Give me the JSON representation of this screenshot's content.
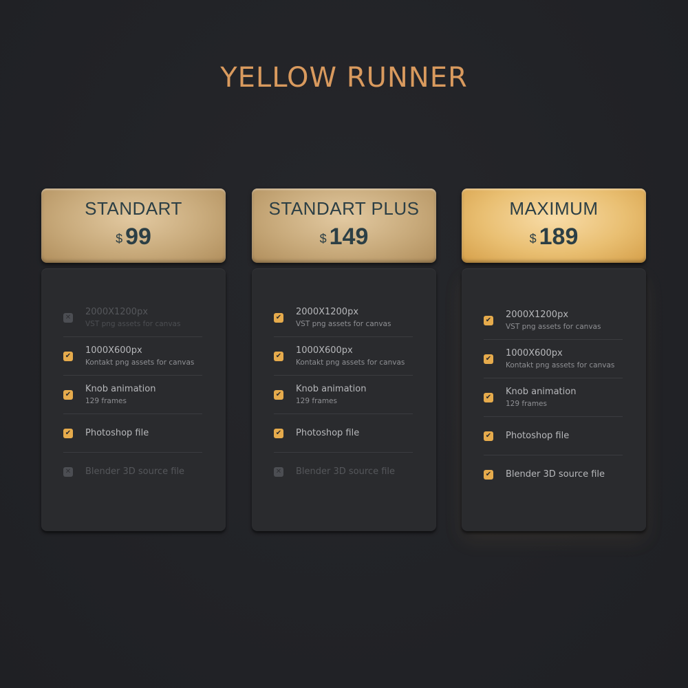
{
  "title": "YELLOW RUNNER",
  "colors": {
    "title": "#d99a5e",
    "check_on": "#e6ab4c",
    "check_off": "#4c4e53",
    "header_text": "#2c3f45",
    "background": "#222327",
    "card": "#2a2b2e"
  },
  "icons": {
    "included": "check-icon",
    "excluded": "x-icon"
  },
  "plans": [
    {
      "name": "STANDART",
      "currency": "$",
      "price": "99",
      "features": [
        {
          "title": "2000X1200px",
          "subtitle": "VST png assets for canvas",
          "included": false,
          "glyph": "✕"
        },
        {
          "title": "1000X600px",
          "subtitle": "Kontakt png assets for canvas",
          "included": true,
          "glyph": "✔"
        },
        {
          "title": "Knob animation",
          "subtitle": "129 frames",
          "included": true,
          "glyph": "✔"
        },
        {
          "title": "Photoshop file",
          "subtitle": "",
          "included": true,
          "glyph": "✔"
        },
        {
          "title": "Blender 3D source file",
          "subtitle": "",
          "included": false,
          "glyph": "✕"
        }
      ]
    },
    {
      "name": "STANDART PLUS",
      "currency": "$",
      "price": "149",
      "features": [
        {
          "title": "2000X1200px",
          "subtitle": "VST png assets for canvas",
          "included": true,
          "glyph": "✔"
        },
        {
          "title": "1000X600px",
          "subtitle": "Kontakt png assets for canvas",
          "included": true,
          "glyph": "✔"
        },
        {
          "title": "Knob animation",
          "subtitle": "129 frames",
          "included": true,
          "glyph": "✔"
        },
        {
          "title": "Photoshop file",
          "subtitle": "",
          "included": true,
          "glyph": "✔"
        },
        {
          "title": "Blender 3D source file",
          "subtitle": "",
          "included": false,
          "glyph": "✕"
        }
      ]
    },
    {
      "name": "MAXIMUM",
      "currency": "$",
      "price": "189",
      "features": [
        {
          "title": "2000X1200px",
          "subtitle": "VST png assets for canvas",
          "included": true,
          "glyph": "✔"
        },
        {
          "title": "1000X600px",
          "subtitle": "Kontakt png assets for canvas",
          "included": true,
          "glyph": "✔"
        },
        {
          "title": "Knob animation",
          "subtitle": "129 frames",
          "included": true,
          "glyph": "✔"
        },
        {
          "title": "Photoshop file",
          "subtitle": "",
          "included": true,
          "glyph": "✔"
        },
        {
          "title": "Blender 3D source file",
          "subtitle": "",
          "included": true,
          "glyph": "✔"
        }
      ]
    }
  ]
}
